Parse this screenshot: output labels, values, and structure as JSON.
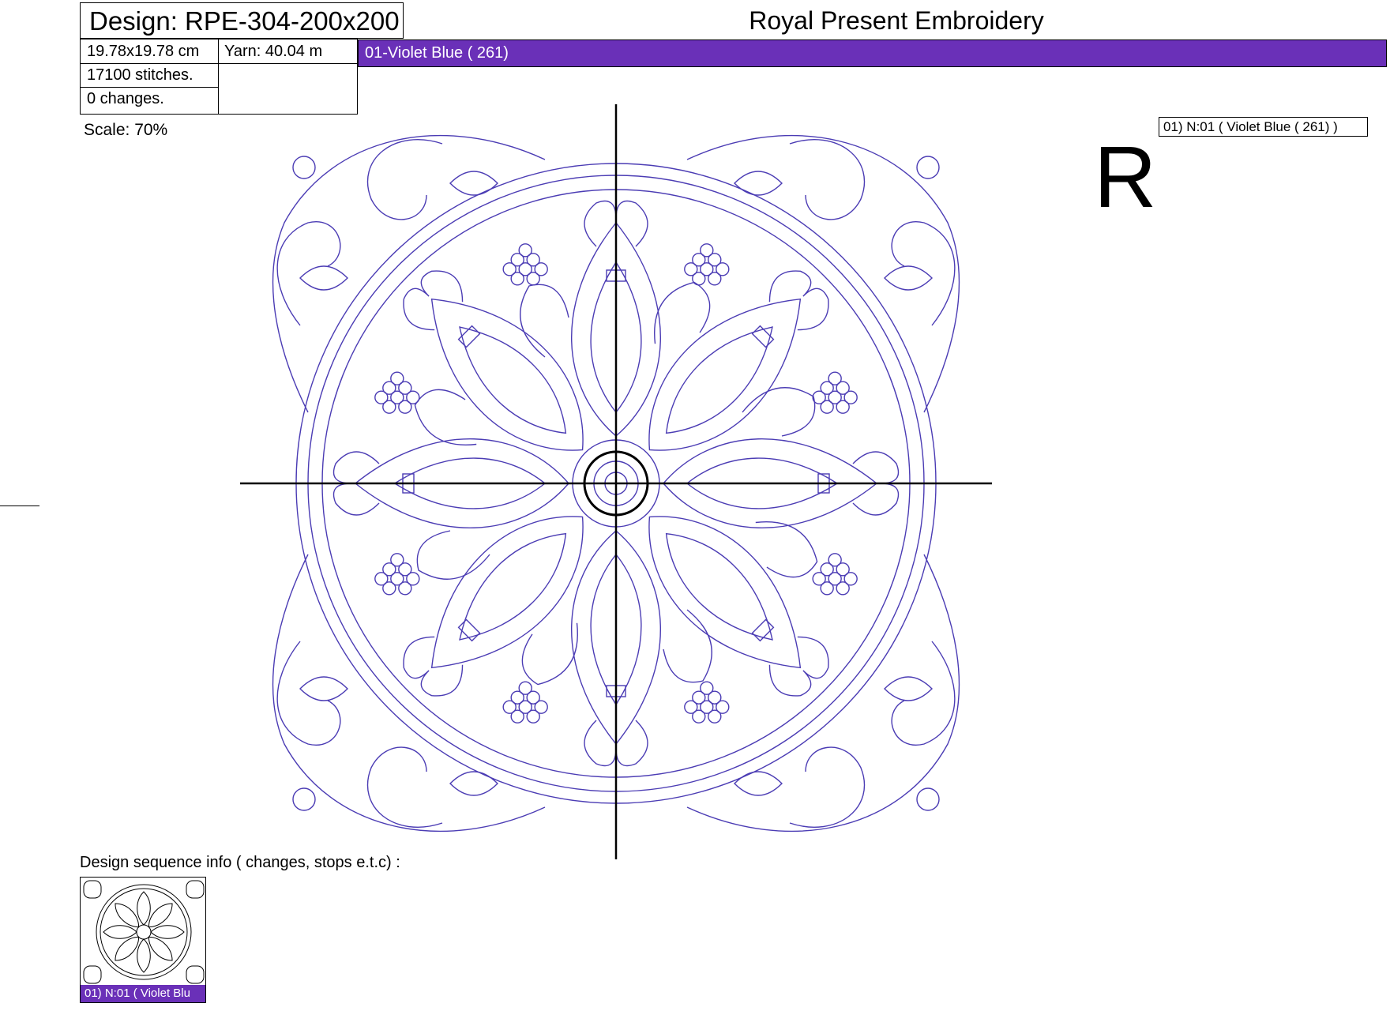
{
  "header": {
    "design_title": "Design: RPE-304-200x200",
    "company": "Royal Present Embroidery"
  },
  "info": {
    "size": "19.78x19.78 cm",
    "yarn": "Yarn: 40.04 m",
    "stitches": "17100 stitches.",
    "changes": "0 changes."
  },
  "color_bar": {
    "label": "01-Violet Blue   ( 261)",
    "color": "#6a30b8"
  },
  "scale": "Scale: 70%",
  "legend": "01)   N:01  ( Violet Blue  ( 261)  )",
  "orientation_mark": "R",
  "sequence": {
    "label": "Design sequence info   ( changes, stops e.t.c)  :",
    "thumb_caption": "01)   N:01   ( Violet Blu"
  },
  "colors": {
    "stitch": "#4b3cb4",
    "crosshair": "#000000"
  }
}
